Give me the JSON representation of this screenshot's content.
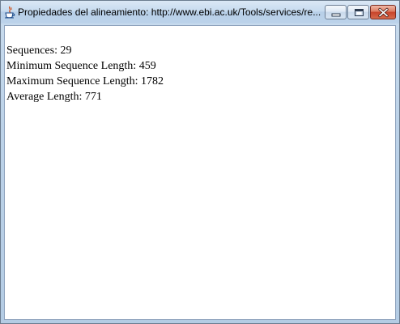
{
  "window": {
    "title": "Propiedades del alineamiento: http://www.ebi.ac.uk/Tools/services/re..."
  },
  "controls": {
    "minimize_icon": "minimize-icon",
    "maximize_icon": "maximize-icon",
    "close_icon": "close-icon"
  },
  "properties": {
    "sequences": "Sequences: 29",
    "min_length": "Minimum Sequence Length: 459",
    "max_length": "Maximum Sequence Length: 1782",
    "avg_length": "Average Length: 771"
  }
}
